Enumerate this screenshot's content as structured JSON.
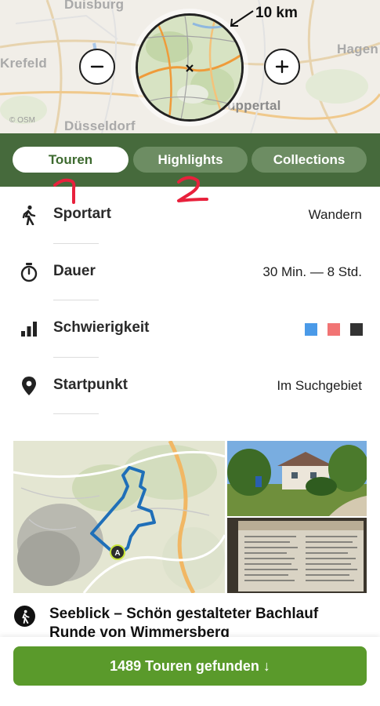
{
  "map": {
    "cities": [
      "Duisburg",
      "Krefeld",
      "Hagen",
      "Düsseldorf",
      "Wuppertal"
    ],
    "attribution": "© OSM",
    "radius_label": "10 km",
    "zoom_out_icon": "minus-icon",
    "zoom_in_icon": "plus-icon"
  },
  "tabs": [
    {
      "label": "Touren",
      "active": true
    },
    {
      "label": "Highlights",
      "active": false
    },
    {
      "label": "Collections",
      "active": false
    }
  ],
  "annotations": [
    "1",
    "2"
  ],
  "filters": [
    {
      "icon": "hiker-icon",
      "label": "Sportart",
      "value": "Wandern"
    },
    {
      "icon": "stopwatch-icon",
      "label": "Dauer",
      "value": "30 Min. — 8 Std."
    },
    {
      "icon": "signal-bars-icon",
      "label": "Schwierigkeit",
      "value": ""
    },
    {
      "icon": "location-pin-icon",
      "label": "Startpunkt",
      "value": "Im Suchgebiet"
    }
  ],
  "difficulty_colors": [
    "#4a9ae8",
    "#f17474",
    "#333333"
  ],
  "tour": {
    "start_marker": "A",
    "title_line1": "Seeblick – Schön gestalteter Bachlauf",
    "title_line2": "Runde von Wimmersberg"
  },
  "results_button": "1489 Touren gefunden ↓",
  "colors": {
    "tab_bar": "#466a3c",
    "active_tab_text": "#3d6a2f",
    "results_button": "#5a9a2b",
    "route": "#1f6fb8"
  }
}
